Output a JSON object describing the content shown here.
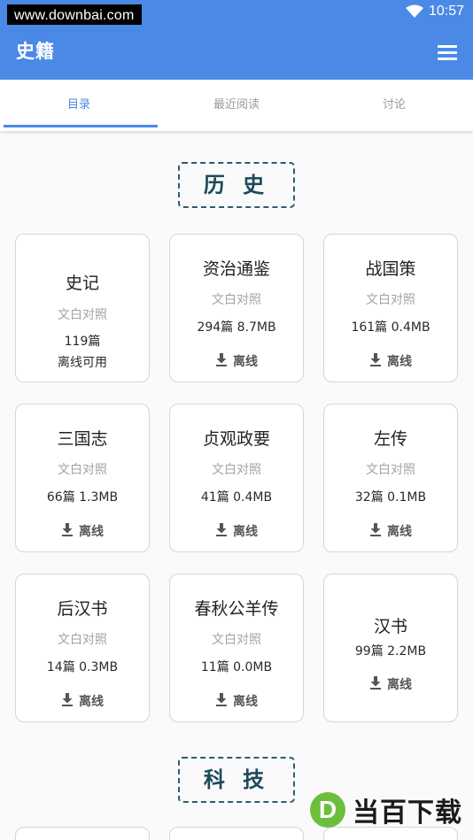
{
  "status_bar": {
    "watermark_url": "www.downbai.com",
    "time": "10:57",
    "icons": [
      "wifi-icon",
      "signal-icon",
      "battery-icon"
    ]
  },
  "app_bar": {
    "title": "史籍",
    "menu_icon": "hamburger-menu-icon"
  },
  "tabs": [
    {
      "label": "目录",
      "active": true
    },
    {
      "label": "最近阅读",
      "active": false
    },
    {
      "label": "讨论",
      "active": false
    }
  ],
  "sections": [
    {
      "title": "历 史"
    },
    {
      "title": "科 技"
    }
  ],
  "books": [
    {
      "name": "史记",
      "sub": "文白对照",
      "stats": "119篇",
      "status": "离线可用"
    },
    {
      "name": "资治通鉴",
      "sub": "文白对照",
      "stats": "294篇 8.7MB",
      "action": "离线"
    },
    {
      "name": "战国策",
      "sub": "文白对照",
      "stats": "161篇 0.4MB",
      "action": "离线"
    },
    {
      "name": "三国志",
      "sub": "文白对照",
      "stats": "66篇 1.3MB",
      "action": "离线"
    },
    {
      "name": "贞观政要",
      "sub": "文白对照",
      "stats": "41篇 0.4MB",
      "action": "离线"
    },
    {
      "name": "左传",
      "sub": "文白对照",
      "stats": "32篇 0.1MB",
      "action": "离线"
    },
    {
      "name": "后汉书",
      "sub": "文白对照",
      "stats": "14篇 0.3MB",
      "action": "离线"
    },
    {
      "name": "春秋公羊传",
      "sub": "文白对照",
      "stats": "11篇 0.0MB",
      "action": "离线"
    },
    {
      "name": "汉书",
      "stats": "99篇 2.2MB",
      "action": "离线"
    }
  ],
  "watermark_logo": {
    "badge": "D",
    "text": "当百下载"
  },
  "colors": {
    "primary": "#4a8ae6",
    "section_border": "#2c5d6f",
    "logo_green": "#6dbe3e"
  }
}
